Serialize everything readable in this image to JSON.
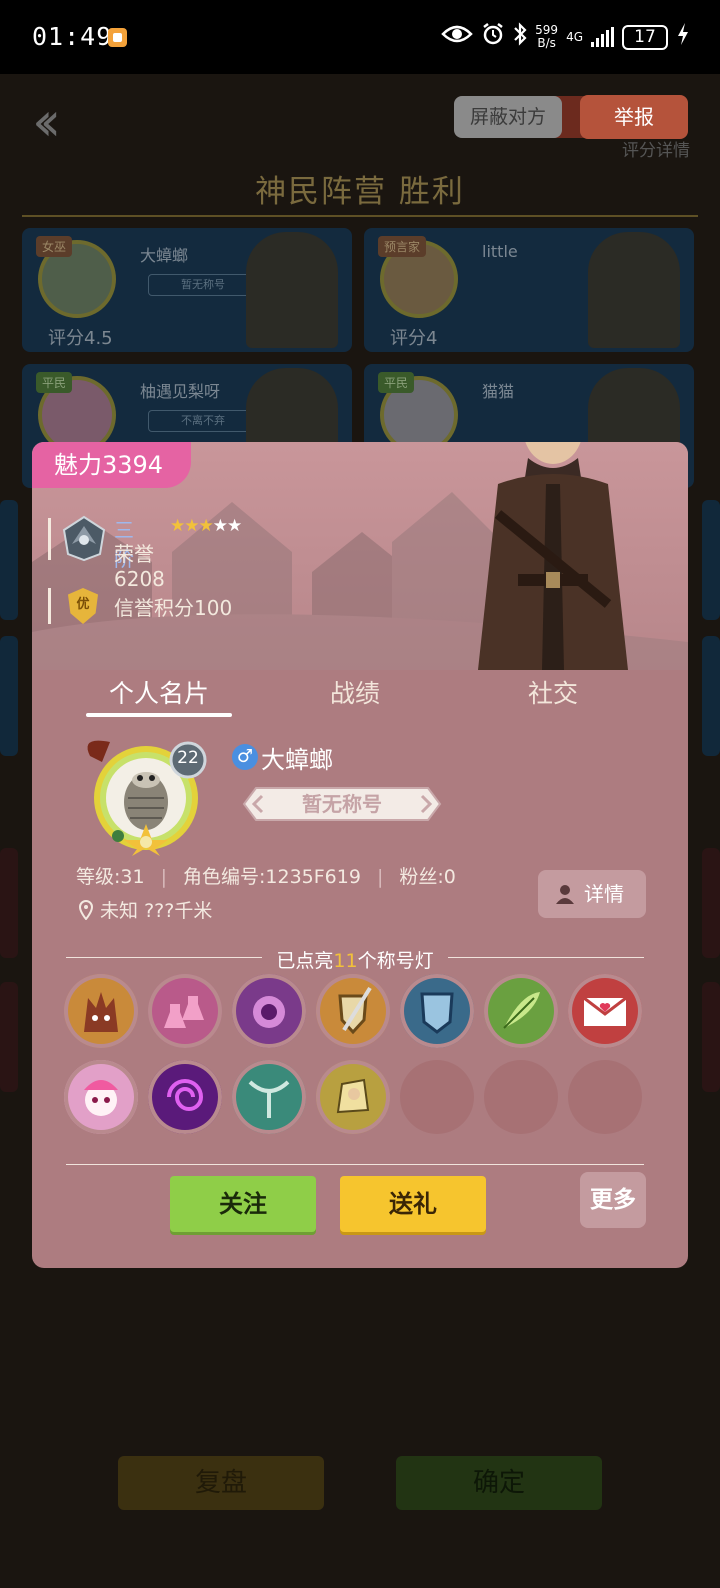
{
  "status_bar": {
    "time": "01:49",
    "net_speed_value": "599",
    "net_speed_unit": "B/s",
    "network": "4G",
    "battery": "17"
  },
  "background": {
    "block_label": "屏蔽对方",
    "report_label": "举报",
    "score_detail": "评分详情",
    "camp_title": "神民阵营  胜利",
    "players": [
      {
        "role": "女巫",
        "name": "大蟑螂",
        "title": "暂无称号",
        "score": "评分4.5"
      },
      {
        "role": "预言家",
        "name": "little",
        "title": "",
        "score": "评分4"
      },
      {
        "role": "平民",
        "name": "柚遇见梨呀",
        "title": "不离不弃",
        "score": ""
      },
      {
        "role": "平民",
        "name": "猫猫",
        "title": "",
        "score": ""
      }
    ],
    "replay_label": "复盘",
    "confirm_label": "确定"
  },
  "modal": {
    "charm_label": "魅力",
    "charm_value": "3394",
    "rank_tier": "三阶",
    "stars_lit": 3,
    "stars_total": 5,
    "honor_label": "荣誉",
    "honor_value": "6208",
    "credit_badge": "优",
    "credit_text": "信誉积分100",
    "tabs": [
      "个人名片",
      "战绩",
      "社交"
    ],
    "active_tab": 0,
    "level_badge": "22",
    "gender_symbol": "♂",
    "player_name": "大蟑螂",
    "player_title": "暂无称号",
    "stat_level": "等级:31",
    "stat_id": "角色编号:1235F619",
    "stat_fans": "粉丝:0",
    "location": "未知  ???千米",
    "detail_label": "详情",
    "lamps_prefix": "已点亮",
    "lamps_count": "11",
    "lamps_suffix": "个称号灯",
    "badges": [
      "werewolf-badge",
      "potion-badge",
      "witch-badge",
      "shield-sword-badge",
      "guard-badge",
      "herb-badge",
      "love-letter-badge",
      "pink-girl-badge",
      "vortex-badge",
      "crossbow-badge",
      "knight-badge",
      "empty",
      "empty",
      "empty"
    ],
    "follow_label": "关注",
    "gift_label": "送礼",
    "more_label": "更多"
  },
  "colors": {
    "modal_bg": "#ad7c80",
    "charm_pink": "#e563a3",
    "follow_green": "#8fce48",
    "gift_yellow": "#f6c52e",
    "star_gold": "#f2c13a",
    "rank_blue": "#9fb8ec"
  }
}
